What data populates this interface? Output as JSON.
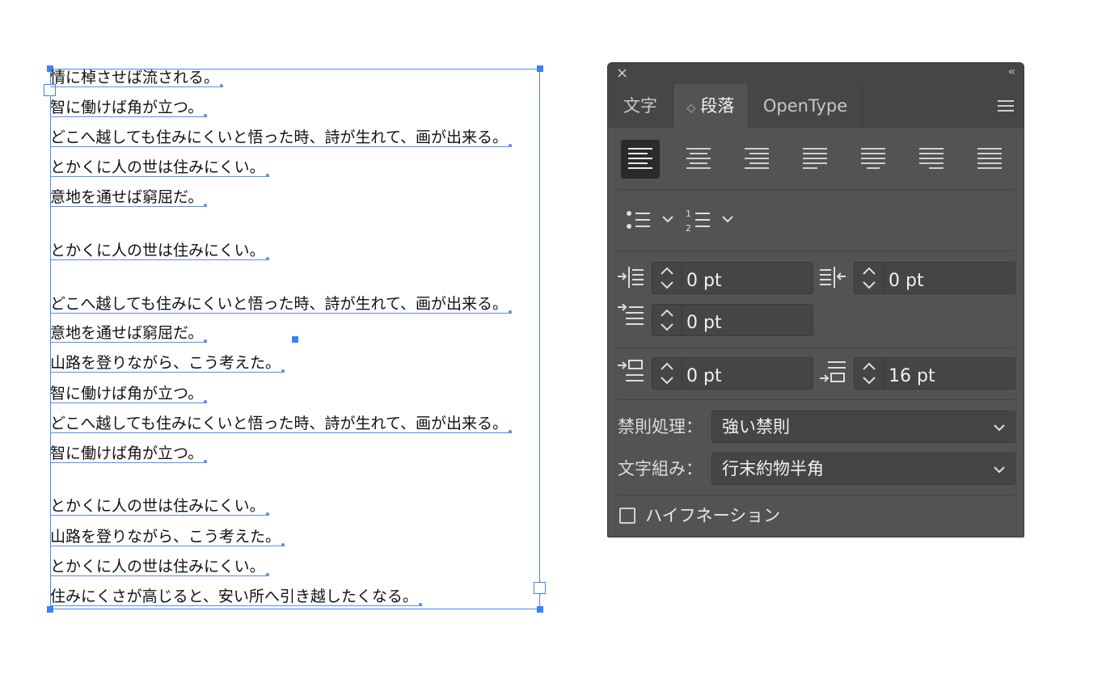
{
  "canvas": {
    "lines": [
      "情に棹させば流される。",
      "智に働けば角が立つ。",
      "どこへ越しても住みにくいと悟った時、詩が生れて、画が出来る。",
      "とかくに人の世は住みにくい。",
      "意地を通せば窮屈だ。",
      "",
      "とかくに人の世は住みにくい。",
      "",
      "どこへ越しても住みにくいと悟った時、詩が生れて、画が出来る。",
      "意地を通せば窮屈だ。",
      "山路を登りながら、こう考えた。",
      "智に働けば角が立つ。",
      "どこへ越しても住みにくいと悟った時、詩が生れて、画が出来る。",
      "智に働けば角が立つ。",
      "",
      "とかくに人の世は住みにくい。",
      "山路を登りながら、こう考えた。",
      "とかくに人の世は住みにくい。",
      "住みにくさが高じると、安い所へ引き越したくなる。"
    ]
  },
  "panel": {
    "close_icon": "×",
    "collapse_icon": "‹‹",
    "tabs": [
      {
        "label": "文字"
      },
      {
        "label": "段落",
        "active": true,
        "prefix": "◇"
      },
      {
        "label": "OpenType"
      }
    ],
    "alignment": {
      "options": [
        "align-left",
        "align-center",
        "align-right",
        "justify-last-left",
        "justify-last-center",
        "justify-last-right",
        "justify-all"
      ],
      "selected": "align-left"
    },
    "fields": {
      "left_indent": "0 pt",
      "right_indent": "0 pt",
      "first_line_indent": "0 pt",
      "space_before": "0 pt",
      "space_after": "16 pt"
    },
    "kinsoku": {
      "label": "禁則処理：",
      "value": "強い禁則"
    },
    "mojikumi": {
      "label": "文字組み：",
      "value": "行末約物半角"
    },
    "hyphenation": {
      "label": "ハイフネーション",
      "checked": false
    }
  },
  "colors": {
    "selection": "#4a86e8",
    "panel_bg": "#535353",
    "panel_header": "#464646"
  }
}
